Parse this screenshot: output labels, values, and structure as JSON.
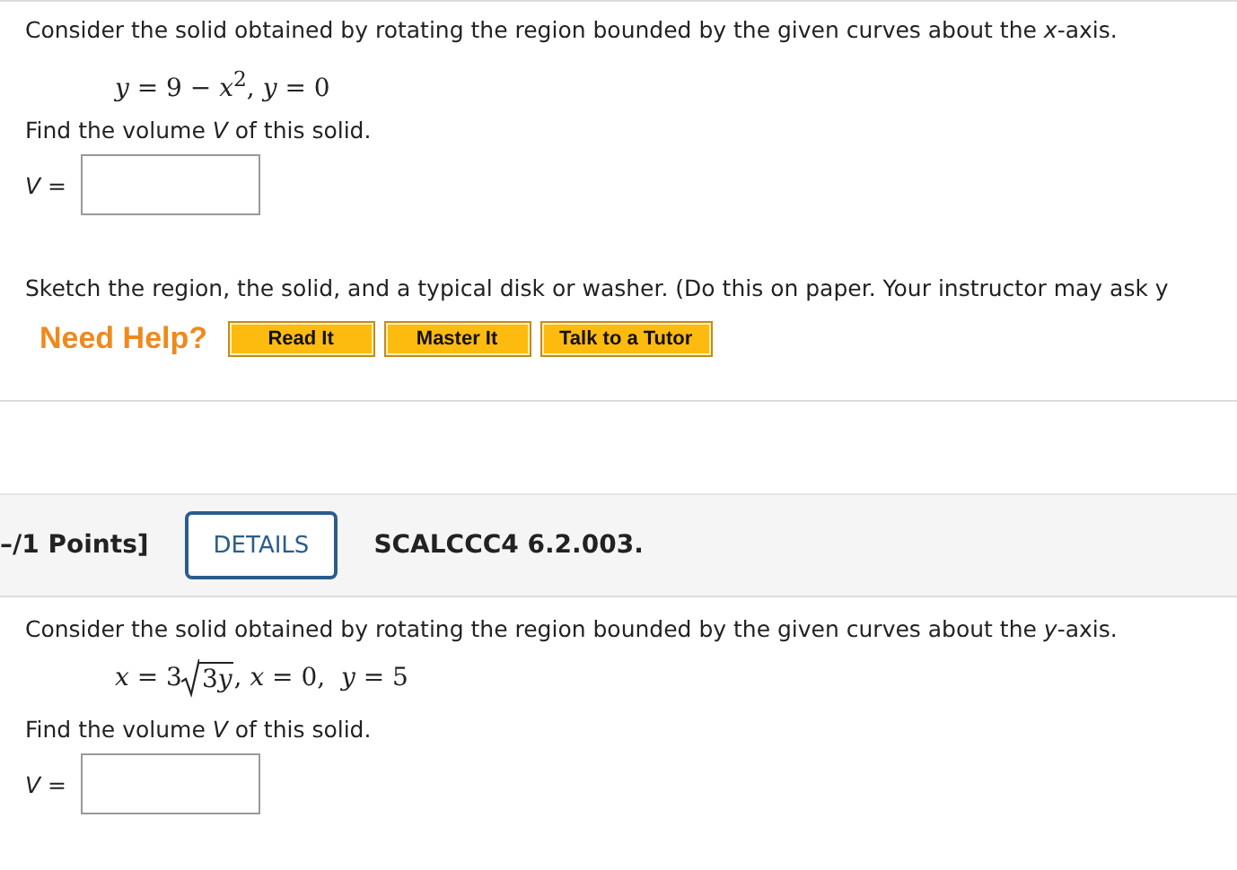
{
  "questions": [
    {
      "prompt": "Consider the solid obtained by rotating the region bounded by the given curves about the *x*-axis.",
      "equation": {
        "before": "*y* = 9 − *x*$^{2}$, *y* = 0"
      },
      "find": "Find the volume *V* of this solid.",
      "answer_label": "*V* =",
      "sketch": "Sketch the region, the solid, and a typical disk or washer. (Do this on paper. Your instructor may ask y",
      "help": {
        "label": "Need Help?",
        "buttons": [
          "Read It",
          "Master It",
          "Talk to a Tutor"
        ]
      }
    },
    {
      "header": {
        "points": "–/1 Points]",
        "details": "DETAILS",
        "code": "SCALCCC4 6.2.003."
      },
      "prompt": "Consider the solid obtained by rotating the region bounded by the given curves about the *y*-axis.",
      "equation": {
        "before": "*x* = 3",
        "radical": {
          "number": "3",
          "variable": "y"
        },
        "after": ", *x* = 0,  *y* = 5"
      },
      "find": "Find the volume *V* of this solid.",
      "answer_label": "*V* ="
    }
  ]
}
